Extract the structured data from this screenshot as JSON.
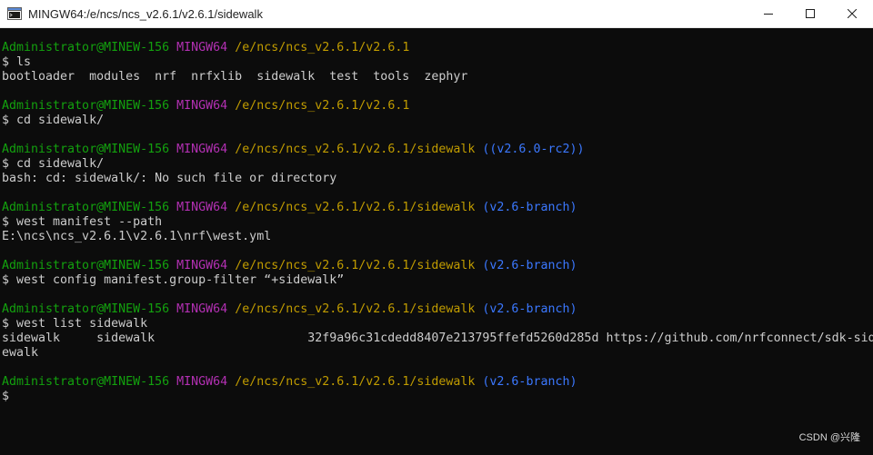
{
  "window": {
    "title": "MINGW64:/e/ncs/ncs_v2.6.1/v2.6.1/sidewalk",
    "app_icon": "mingw-terminal-icon",
    "controls": {
      "minimize": "minimize-icon",
      "maximize": "maximize-icon",
      "close": "close-icon"
    }
  },
  "colors": {
    "background": "#0c0c0c",
    "user": "#13a10e",
    "system": "#b330b3",
    "path": "#c19c00",
    "branch": "#3b78ff",
    "text": "#cccccc"
  },
  "prompt": {
    "user": "Administrator@MINEW-156",
    "system": "MINGW64",
    "dollar": "$"
  },
  "console": {
    "p1_path": "/e/ncs/ncs_v2.6.1/v2.6.1",
    "cmd1": "$ ls",
    "out1": "bootloader  modules  nrf  nrfxlib  sidewalk  test  tools  zephyr",
    "p2_path": "/e/ncs/ncs_v2.6.1/v2.6.1",
    "cmd2": "$ cd sidewalk/",
    "p3_path": "/e/ncs/ncs_v2.6.1/v2.6.1/sidewalk",
    "p3_branch": "((v2.6.0-rc2))",
    "cmd3": "$ cd sidewalk/",
    "out3": "bash: cd: sidewalk/: No such file or directory",
    "p4_path": "/e/ncs/ncs_v2.6.1/v2.6.1/sidewalk",
    "p4_branch": "(v2.6-branch)",
    "cmd4": "$ west manifest --path",
    "out4": "E:\\ncs\\ncs_v2.6.1\\v2.6.1\\nrf\\west.yml",
    "p5_path": "/e/ncs/ncs_v2.6.1/v2.6.1/sidewalk",
    "p5_branch": "(v2.6-branch)",
    "cmd5": "$ west config manifest.group-filter “+sidewalk”",
    "p6_path": "/e/ncs/ncs_v2.6.1/v2.6.1/sidewalk",
    "p6_branch": "(v2.6-branch)",
    "cmd6": "$ west list sidewalk",
    "out6a": "sidewalk     sidewalk                     32f9a96c31cdedd8407e213795ffefd5260d285d https://github.com/nrfconnect/sdk-sid",
    "out6b": "ewalk",
    "p7_path": "/e/ncs/ncs_v2.6.1/v2.6.1/sidewalk",
    "p7_branch": "(v2.6-branch)",
    "cursor_line": "$"
  },
  "watermark": "CSDN @兴隆"
}
